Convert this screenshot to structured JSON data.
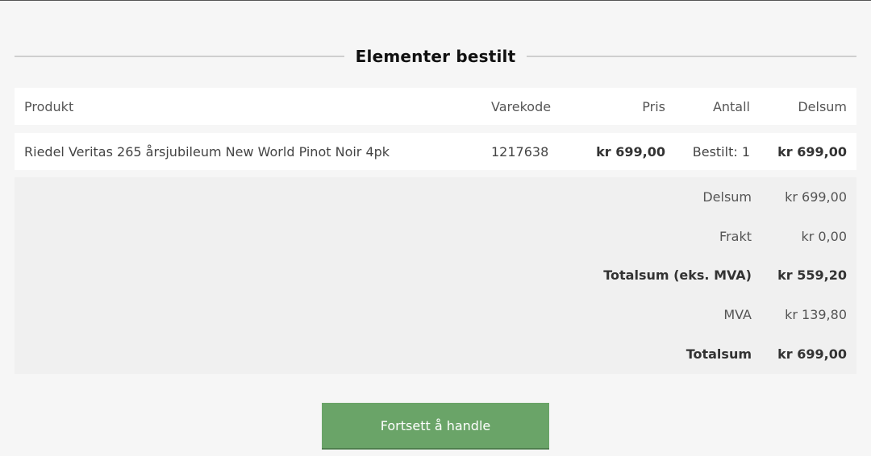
{
  "section": {
    "title": "Elementer bestilt"
  },
  "table": {
    "headers": {
      "product": "Produkt",
      "sku": "Varekode",
      "price": "Pris",
      "quantity": "Antall",
      "subtotal": "Delsum"
    },
    "rows": [
      {
        "product": "Riedel Veritas 265 årsjubileum New World Pinot Noir 4pk",
        "sku": "1217638",
        "price": "kr 699,00",
        "quantity": "Bestilt: 1",
        "subtotal": "kr 699,00"
      }
    ]
  },
  "totals": {
    "subtotal_label": "Delsum",
    "subtotal_value": "kr 699,00",
    "shipping_label": "Frakt",
    "shipping_value": "kr 0,00",
    "total_ex_vat_label": "Totalsum (eks. MVA)",
    "total_ex_vat_value": "kr 559,20",
    "vat_label": "MVA",
    "vat_value": "kr 139,80",
    "grand_total_label": "Totalsum",
    "grand_total_value": "kr 699,00"
  },
  "actions": {
    "continue_label": "Fortsett å handle"
  },
  "colors": {
    "button_green": "#6aa468",
    "background": "#f6f6f6"
  }
}
